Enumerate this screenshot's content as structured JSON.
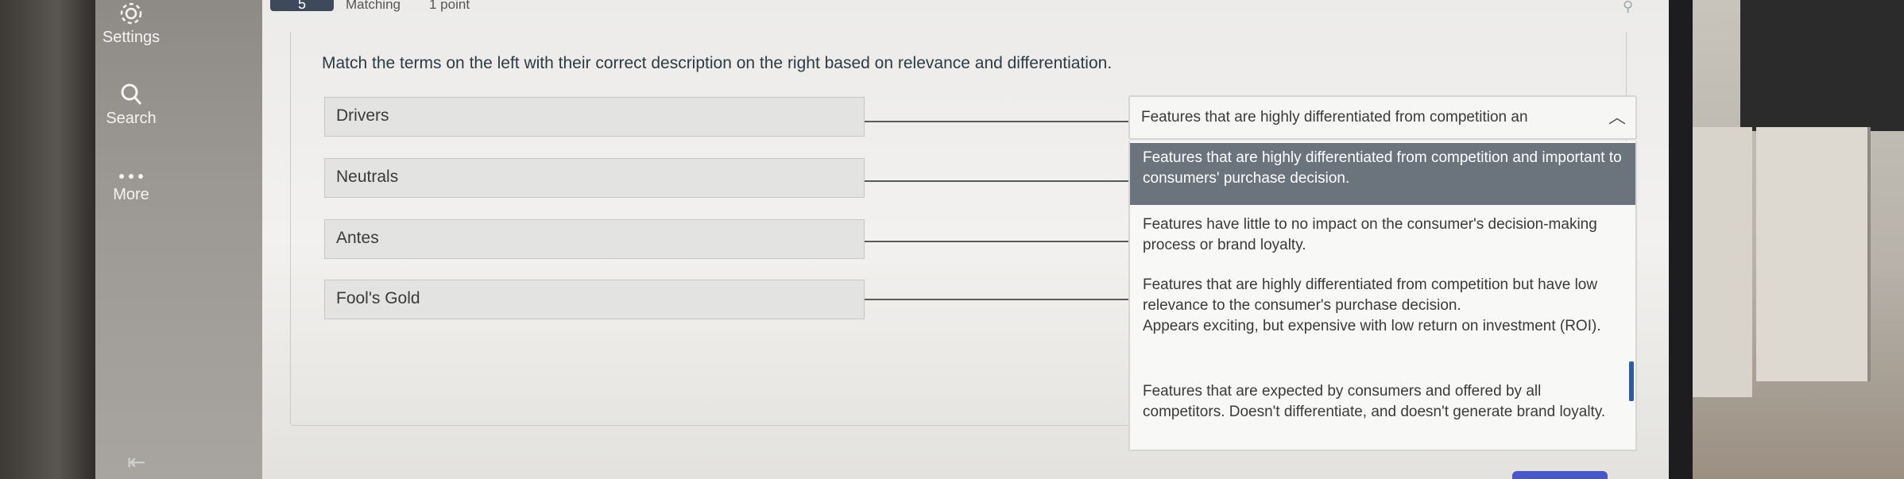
{
  "nav": {
    "items": [
      {
        "label": "Settings",
        "icon": "gear-icon"
      },
      {
        "label": "Search",
        "icon": "search-icon"
      },
      {
        "label": "More",
        "icon": "more-dots-icon"
      }
    ],
    "collapse_icon": "collapse-arrow-icon"
  },
  "question": {
    "number": "5",
    "type": "Matching",
    "points": "1 point",
    "prompt": "Match the terms on the left with their correct description on the right based on relevance and differentiation.",
    "terms": [
      "Drivers",
      "Neutrals",
      "Antes",
      "Fool's Gold"
    ],
    "select": {
      "selected_value": "Features that are highly differentiated from competition an",
      "options": [
        "Features that are highly differentiated from competition and important to consumers' purchase decision.",
        "Features have little to no impact on the consumer's decision-making process or brand loyalty.",
        "Features that are highly differentiated from competition but have low relevance to the consumer's purchase decision.",
        "Appears exciting, but expensive with low return on investment (ROI).",
        "Features that are expected by consumers and offered by all competitors. Doesn't differentiate, and doesn't generate brand loyalty."
      ]
    }
  },
  "colors": {
    "active_option": "#6b737d",
    "accent": "#2e5aa8"
  }
}
